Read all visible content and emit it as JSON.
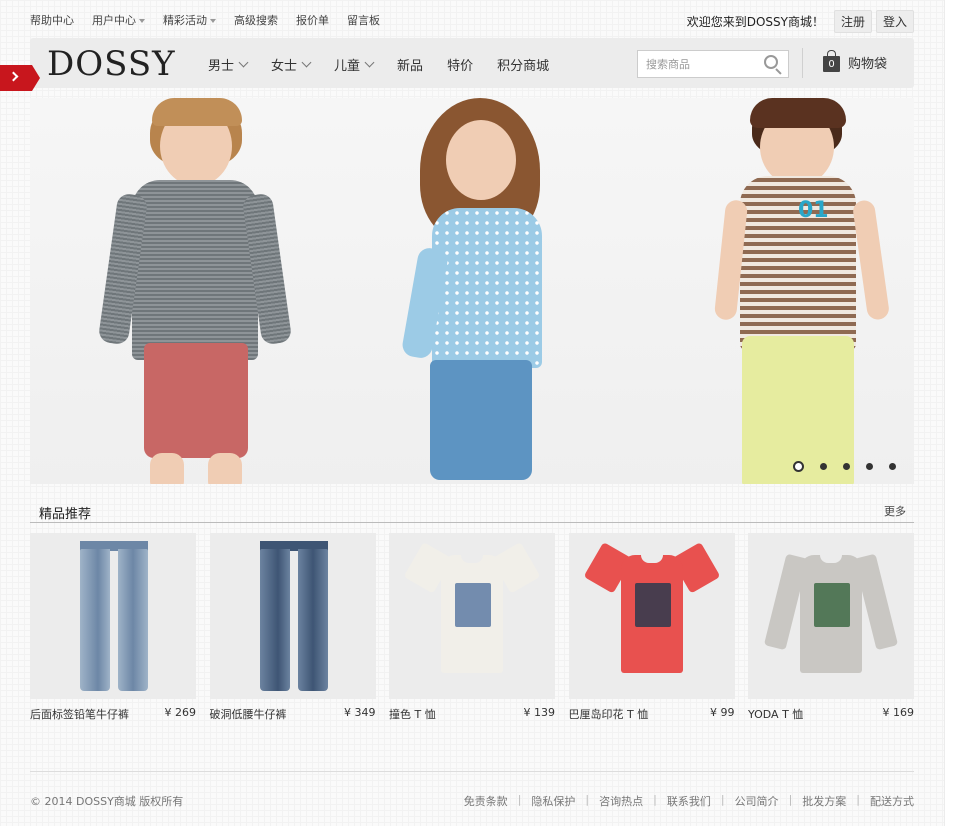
{
  "topbar": {
    "links": [
      {
        "label": "帮助中心",
        "dropdown": false
      },
      {
        "label": "用户中心",
        "dropdown": true
      },
      {
        "label": "精彩活动",
        "dropdown": true
      },
      {
        "label": "高级搜索",
        "dropdown": false
      },
      {
        "label": "报价单",
        "dropdown": false
      },
      {
        "label": "留言板",
        "dropdown": false
      }
    ],
    "welcome": "欢迎您来到DOSSY商城！",
    "register": "注册",
    "login": "登入"
  },
  "nav": {
    "logo": "DOSSY",
    "menu": [
      {
        "label": "男士",
        "dropdown": true
      },
      {
        "label": "女士",
        "dropdown": true
      },
      {
        "label": "儿童",
        "dropdown": true
      },
      {
        "label": "新品",
        "dropdown": false
      },
      {
        "label": "特价",
        "dropdown": false
      },
      {
        "label": "积分商城",
        "dropdown": false
      }
    ],
    "search_placeholder": "搜索商品",
    "cart_count": "0",
    "cart_label": "购物袋"
  },
  "banner": {
    "slides_total": 5,
    "active_slide": 1,
    "shirt_print": "01"
  },
  "section": {
    "title": "精品推荐",
    "more": "更多"
  },
  "products": [
    {
      "name": "后面标签铅笔牛仔裤",
      "price": "¥ 269",
      "kind": "jeans",
      "color": "#6d87a6",
      "accent": "#9fb3c8"
    },
    {
      "name": "破洞低腰牛仔裤",
      "price": "¥ 349",
      "kind": "jeans",
      "color": "#3e5574",
      "accent": "#6c83a0"
    },
    {
      "name": "撞色 T 恤",
      "price": "¥ 139",
      "kind": "tee",
      "color": "#f1efe9",
      "accent": "#5d7aa3"
    },
    {
      "name": "巴厘岛印花 T 恤",
      "price": "¥ 99",
      "kind": "tee",
      "color": "#e8514f",
      "accent": "#2b3a4d"
    },
    {
      "name": "YODA T 恤",
      "price": "¥ 169",
      "kind": "longsleeve",
      "color": "#c9c7c3",
      "accent": "#3e6a45"
    }
  ],
  "footer": {
    "copyright": "© 2014 DOSSY商城 版权所有",
    "links": [
      "免责条款",
      "隐私保护",
      "咨询热点",
      "联系我们",
      "公司简介",
      "批发方案",
      "配送方式"
    ]
  }
}
